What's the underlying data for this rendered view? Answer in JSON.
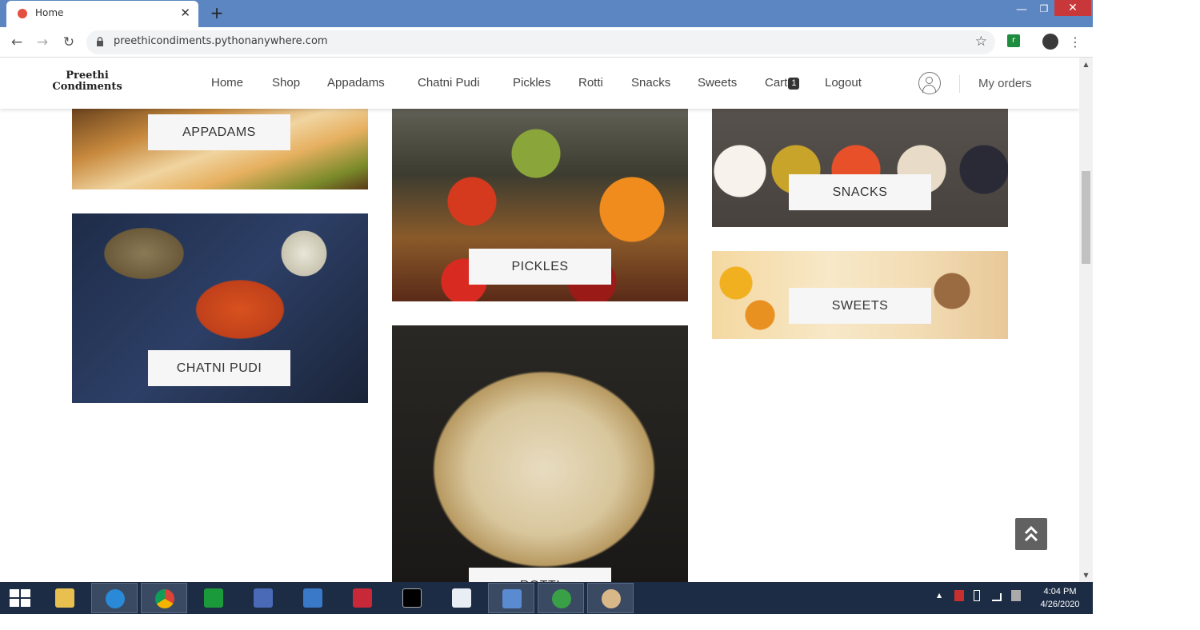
{
  "browser": {
    "tab_title": "Home",
    "tab_close": "✕",
    "new_tab": "+",
    "url": "preethicondiments.pythonanywhere.com",
    "window_min": "—",
    "window_max": "❐",
    "window_close": "✕",
    "back": "←",
    "forward": "→",
    "reload": "↻",
    "star": "☆",
    "ext_label": "r",
    "menu": "⋮"
  },
  "site": {
    "logo_line1": "Preethi",
    "logo_line2": "Condiments",
    "nav": [
      "Home",
      "Shop",
      "Appadams",
      "Chatni Pudi",
      "Pickles",
      "Rotti",
      "Snacks",
      "Sweets"
    ],
    "cart_label": "Cart",
    "cart_count": "1",
    "logout": "Logout",
    "my_orders": "My orders"
  },
  "categories": {
    "appadams": "APPADAMS",
    "chatni_pudi": "CHATNI PUDI",
    "pickles": "PICKLES",
    "rotti": "ROTTI",
    "snacks": "SNACKS",
    "sweets": "SWEETS"
  },
  "scroll_top_label": "⌃",
  "taskbar": {
    "time": "4:04 PM",
    "date": "4/26/2020",
    "tray_arrow": "▲"
  },
  "colors": {
    "tabbar": "#5c86c1",
    "window_close": "#c8383a",
    "taskbar": "#1c2c44",
    "scroll_top_bg": "#616161"
  }
}
